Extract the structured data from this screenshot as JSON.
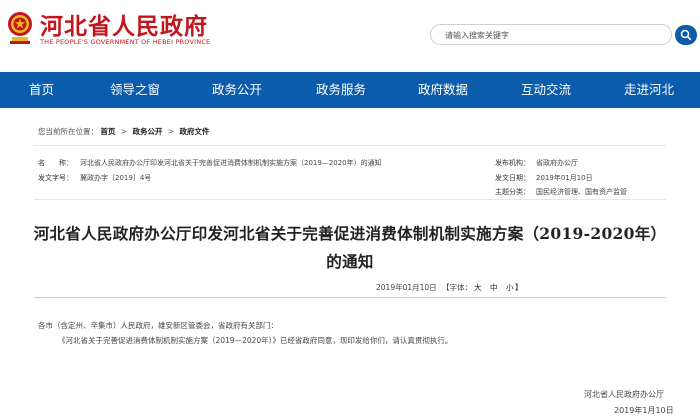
{
  "header": {
    "site_title": "河北省人民政府",
    "site_subtitle": "THE PEOPLE'S GOVERNMENT OF HEBEI PROVINCE",
    "search_placeholder": "请输入搜索关键字",
    "brand_color": "#c3161c",
    "emblem_icon": "national-emblem-icon"
  },
  "nav": {
    "background": "#0b5cad",
    "items": [
      {
        "label": "首页"
      },
      {
        "label": "领导之窗"
      },
      {
        "label": "政务公开"
      },
      {
        "label": "政务服务"
      },
      {
        "label": "政府数据"
      },
      {
        "label": "互动交流"
      },
      {
        "label": "走进河北"
      }
    ]
  },
  "breadcrumb": {
    "prefix": "您当前所在位置：",
    "items": [
      {
        "label": "首页"
      },
      {
        "label": "政务公开"
      },
      {
        "label": "政府文件"
      }
    ],
    "separator": ">"
  },
  "meta": {
    "name_label": "名　　称：",
    "name_value": "河北省人民政府办公厅印发河北省关于完善促进消费体制机制实施方案（2019—2020年）的通知",
    "docno_label": "发文字号：",
    "docno_value": "冀政办字〔2019〕4号",
    "issuer_label": "发布机构：",
    "issuer_value": "省政府办公厅",
    "date_label": "发文日期：",
    "date_value": "2019年01月10日",
    "category_label": "主题分类：",
    "category_value": "国民经济管理、国有资产监管"
  },
  "document": {
    "title_line1": "河北省人民政府办公厅印发河北省关于完善促进消费体制机制实施方案（2019-2020年）",
    "title_line2": "的通知",
    "publish_date": "2019年01月10日",
    "font_size_label": "【字体：",
    "font_large": "大",
    "font_medium": "中",
    "font_small": "小",
    "font_close": "】",
    "addressee": "各市（含定州、辛集市）人民政府，雄安新区管委会，省政府有关部门：",
    "body": "《河北省关于完善促进消费体制机制实施方案（2019—2020年）》已经省政府同意，现印发给你们，请认真贯彻执行。",
    "signer": "河北省人民政府办公厅",
    "sign_date": "2019年1月10日"
  }
}
